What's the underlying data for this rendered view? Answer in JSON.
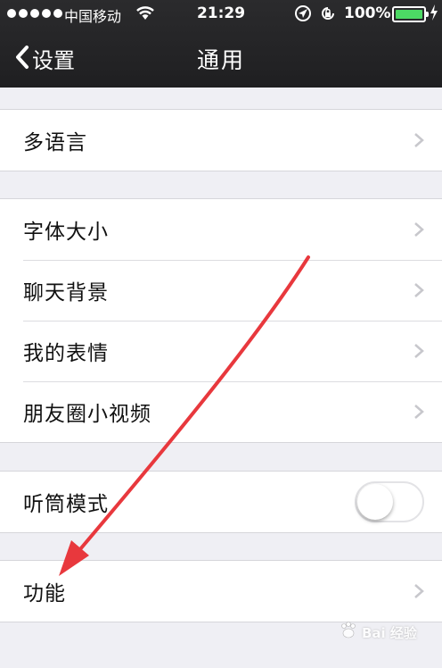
{
  "status_bar": {
    "carrier": "中国移动",
    "time": "21:29",
    "battery_percent": "100%",
    "battery_level": 1.0,
    "signal_bars": 5
  },
  "nav": {
    "back_label": "设置",
    "title": "通用"
  },
  "groups": [
    {
      "rows": [
        {
          "label": "多语言",
          "accessory": "chevron"
        }
      ]
    },
    {
      "rows": [
        {
          "label": "字体大小",
          "accessory": "chevron"
        },
        {
          "label": "聊天背景",
          "accessory": "chevron"
        },
        {
          "label": "我的表情",
          "accessory": "chevron"
        },
        {
          "label": "朋友圈小视频",
          "accessory": "chevron"
        }
      ]
    },
    {
      "rows": [
        {
          "label": "听筒模式",
          "accessory": "toggle",
          "on": false
        }
      ]
    },
    {
      "rows": [
        {
          "label": "功能",
          "accessory": "chevron"
        }
      ]
    }
  ],
  "watermark": {
    "text": "Bai 经验"
  },
  "colors": {
    "background": "#efeff4",
    "navbar": "#222224",
    "battery_fill": "#4cd964",
    "annotation_arrow": "#e8383d"
  }
}
